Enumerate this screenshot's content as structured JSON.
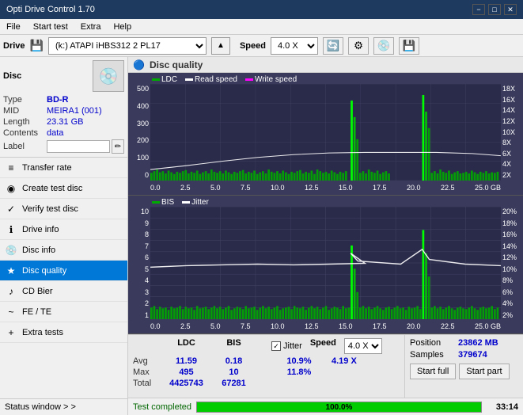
{
  "titlebar": {
    "title": "Opti Drive Control 1.70",
    "minimize": "−",
    "maximize": "□",
    "close": "✕"
  },
  "menu": {
    "items": [
      "File",
      "Start test",
      "Extra",
      "Help"
    ]
  },
  "drivebar": {
    "label": "Drive",
    "drive_value": "(k:) ATAPI iHBS312  2 PL17",
    "speed_label": "Speed",
    "speed_value": "4.0 X"
  },
  "disc": {
    "title": "Disc",
    "type_label": "Type",
    "type_value": "BD-R",
    "mid_label": "MID",
    "mid_value": "MEIRA1 (001)",
    "length_label": "Length",
    "length_value": "23.31 GB",
    "contents_label": "Contents",
    "contents_value": "data",
    "label_label": "Label",
    "label_value": ""
  },
  "nav": {
    "items": [
      {
        "id": "transfer-rate",
        "label": "Transfer rate",
        "icon": "≡"
      },
      {
        "id": "create-test-disc",
        "label": "Create test disc",
        "icon": "◉"
      },
      {
        "id": "verify-test-disc",
        "label": "Verify test disc",
        "icon": "✓"
      },
      {
        "id": "drive-info",
        "label": "Drive info",
        "icon": "ℹ"
      },
      {
        "id": "disc-info",
        "label": "Disc info",
        "icon": "💿"
      },
      {
        "id": "disc-quality",
        "label": "Disc quality",
        "icon": "★",
        "active": true
      },
      {
        "id": "cd-bier",
        "label": "CD Bier",
        "icon": "🎵"
      },
      {
        "id": "fe-te",
        "label": "FE / TE",
        "icon": "~"
      },
      {
        "id": "extra-tests",
        "label": "Extra tests",
        "icon": "+"
      }
    ]
  },
  "status_window": {
    "label": "Status window > >"
  },
  "chart_quality": {
    "title": "Disc quality",
    "legend": [
      {
        "label": "LDC",
        "color": "#00aa00"
      },
      {
        "label": "Read speed",
        "color": "#ffffff"
      },
      {
        "label": "Write speed",
        "color": "#ff00ff"
      }
    ],
    "y_left": [
      "500",
      "400",
      "300",
      "200",
      "100",
      "0"
    ],
    "y_right": [
      "18X",
      "16X",
      "14X",
      "12X",
      "10X",
      "8X",
      "6X",
      "4X",
      "2X"
    ],
    "x_axis": [
      "0.0",
      "2.5",
      "5.0",
      "7.5",
      "10.0",
      "12.5",
      "15.0",
      "17.5",
      "20.0",
      "22.5",
      "25.0 GB"
    ]
  },
  "chart_bis": {
    "legend": [
      {
        "label": "BIS",
        "color": "#00aa00"
      },
      {
        "label": "Jitter",
        "color": "#ffffff"
      }
    ],
    "y_left": [
      "10",
      "9",
      "8",
      "7",
      "6",
      "5",
      "4",
      "3",
      "2",
      "1"
    ],
    "y_right": [
      "20%",
      "18%",
      "16%",
      "14%",
      "12%",
      "10%",
      "8%",
      "6%",
      "4%",
      "2%"
    ],
    "x_axis": [
      "0.0",
      "2.5",
      "5.0",
      "7.5",
      "10.0",
      "12.5",
      "15.0",
      "17.5",
      "20.0",
      "22.5",
      "25.0 GB"
    ]
  },
  "stats": {
    "headers": [
      "LDC",
      "BIS",
      "",
      "Jitter",
      "Speed",
      ""
    ],
    "avg_label": "Avg",
    "avg_ldc": "11.59",
    "avg_bis": "0.18",
    "avg_jitter": "10.9%",
    "avg_speed": "4.19 X",
    "avg_speed_select": "4.0 X",
    "max_label": "Max",
    "max_ldc": "495",
    "max_bis": "10",
    "max_jitter": "11.8%",
    "position_label": "Position",
    "position_val": "23862 MB",
    "total_label": "Total",
    "total_ldc": "4425743",
    "total_bis": "67281",
    "samples_label": "Samples",
    "samples_val": "379674",
    "jitter_checked": true,
    "jitter_label": "Jitter",
    "btn_start_full": "Start full",
    "btn_start_part": "Start part"
  },
  "progress": {
    "status_text": "Test completed",
    "percent": 100,
    "percent_label": "100.0%",
    "time": "33:14"
  }
}
